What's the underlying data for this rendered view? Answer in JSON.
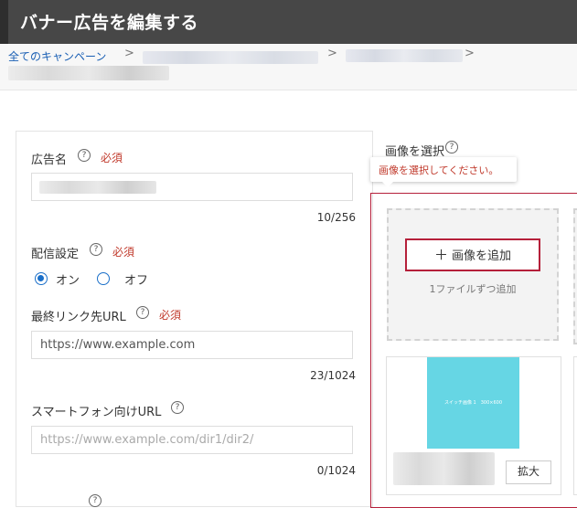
{
  "header": {
    "title": "バナー広告を編集する"
  },
  "breadcrumb": {
    "all_campaigns": "全てのキャンペーン",
    "separator": ">"
  },
  "form": {
    "ad_name": {
      "label": "広告名",
      "required": "必須",
      "counter": "10/256"
    },
    "delivery": {
      "label": "配信設定",
      "required": "必須",
      "on": "オン",
      "off": "オフ",
      "selected": "オン"
    },
    "final_url": {
      "label": "最終リンク先URL",
      "required": "必須",
      "value": "https://www.example.com",
      "counter": "23/1024"
    },
    "smartphone_url": {
      "label": "スマートフォン向けURL",
      "placeholder": "https://www.example.com/dir1/dir2/",
      "counter": "0/1024"
    }
  },
  "image": {
    "title": "画像を選択",
    "error": "画像を選択してください。",
    "add_button": "画像を追加",
    "hint": "1ファイルずつ追加",
    "thumb_text": "スイッチ画像 1　300×600",
    "zoom": "拡大"
  },
  "icons": {
    "help": "question-circle-icon",
    "plus": "plus-icon",
    "chevron": "chevron-right-icon"
  },
  "colors": {
    "accent_red": "#b5203a",
    "link_blue": "#1a5fb4",
    "header_bg": "#474747",
    "thumb_bg": "#66d6e4"
  }
}
